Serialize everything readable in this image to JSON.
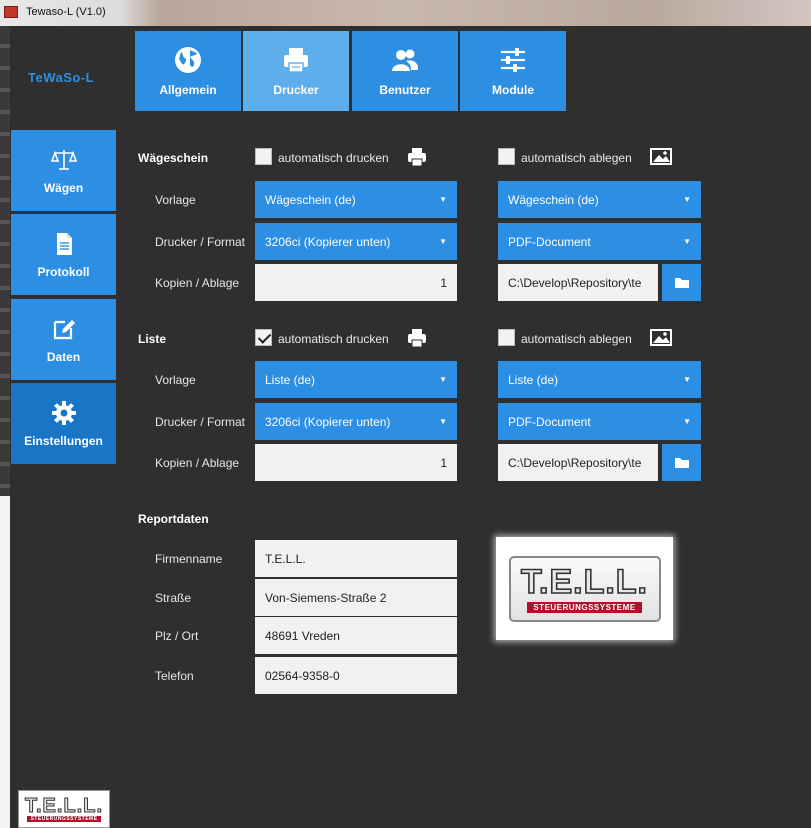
{
  "window": {
    "title": "Tewaso-L (V1.0)"
  },
  "brand": "TeWaSo-L",
  "sidebar": {
    "items": [
      {
        "label": "Wägen",
        "icon": "scale-icon"
      },
      {
        "label": "Protokoll",
        "icon": "document-icon"
      },
      {
        "label": "Daten",
        "icon": "edit-icon"
      },
      {
        "label": "Einstellungen",
        "icon": "gear-icon",
        "active": true
      }
    ]
  },
  "tabs": [
    {
      "label": "Allgemein",
      "icon": "globe-icon"
    },
    {
      "label": "Drucker",
      "icon": "printer-icon",
      "active": true
    },
    {
      "label": "Benutzer",
      "icon": "users-icon"
    },
    {
      "label": "Module",
      "icon": "sliders-icon"
    }
  ],
  "waegeschein": {
    "title": "Wägeschein",
    "print_checkbox": {
      "label": "automatisch drucken",
      "checked": false
    },
    "archive_checkbox": {
      "label": "automatisch ablegen",
      "checked": false
    },
    "vorlage_label": "Vorlage",
    "drucker_label": "Drucker / Format",
    "kopien_label": "Kopien / Ablage",
    "vorlage_print": "Wägeschein (de)",
    "drucker_print": "3206ci (Kopierer unten)",
    "kopien": "1",
    "vorlage_archive": "Wägeschein (de)",
    "format_archive": "PDF-Document",
    "path": "C:\\Develop\\Repository\\te"
  },
  "liste": {
    "title": "Liste",
    "print_checkbox": {
      "label": "automatisch drucken",
      "checked": true
    },
    "archive_checkbox": {
      "label": "automatisch ablegen",
      "checked": false
    },
    "vorlage_label": "Vorlage",
    "drucker_label": "Drucker / Format",
    "kopien_label": "Kopien / Ablage",
    "vorlage_print": "Liste (de)",
    "drucker_print": "3206ci (Kopierer unten)",
    "kopien": "1",
    "vorlage_archive": "Liste (de)",
    "format_archive": "PDF-Document",
    "path": "C:\\Develop\\Repository\\te"
  },
  "report": {
    "title": "Reportdaten",
    "firma_label": "Firmenname",
    "firma": "T.E.L.L.",
    "strasse_label": "Straße",
    "strasse": "Von-Siemens-Straße 2",
    "ort_label": "Plz / Ort",
    "ort": "48691 Vreden",
    "telefon_label": "Telefon",
    "telefon": "02564-9358-0"
  },
  "logo": {
    "name": "T.E.L.L.",
    "sub": "STEUERUNGSSYSTEME"
  },
  "colors": {
    "accent": "#2c8fe3",
    "background": "#2f2f2f",
    "brand_red": "#b0122c"
  }
}
